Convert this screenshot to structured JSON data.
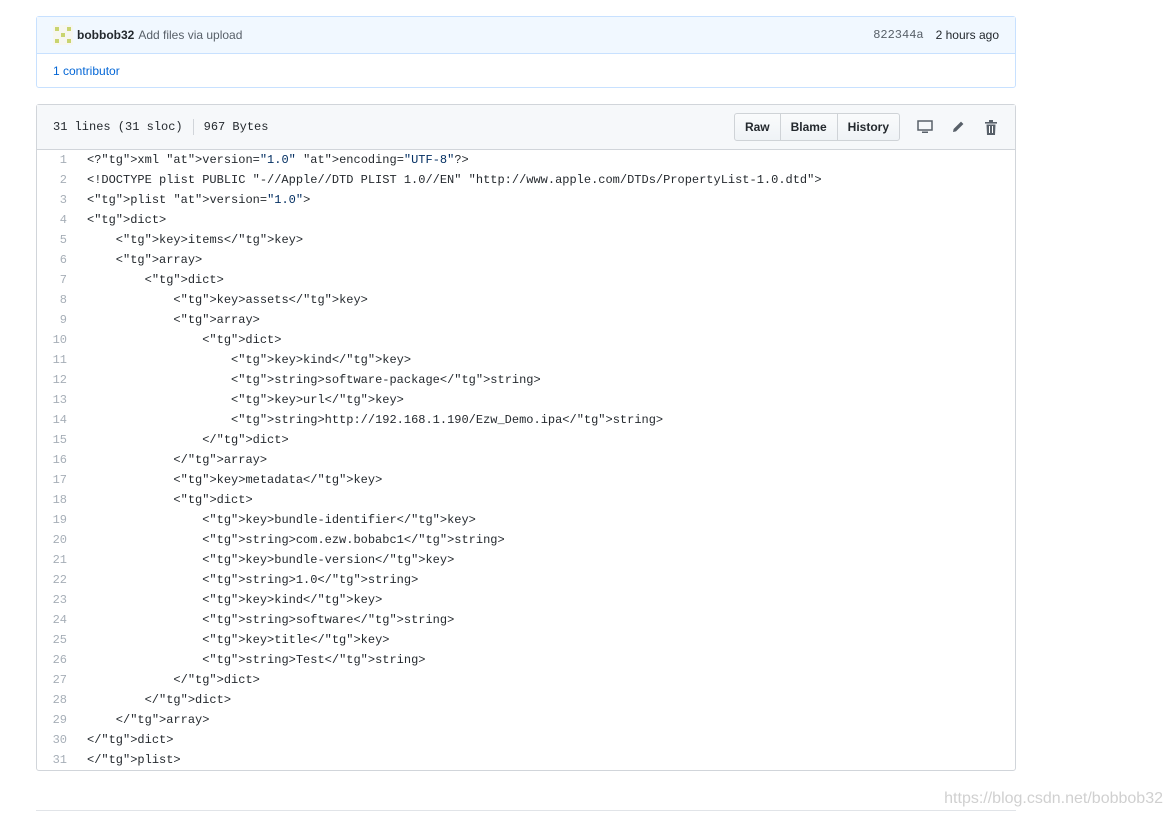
{
  "commit": {
    "author": "bobbob32",
    "message": "Add files via upload",
    "sha": "822344a",
    "time_ago": "2 hours ago",
    "contributors": "1 contributor"
  },
  "file": {
    "lines_info": "31 lines (31 sloc)",
    "size": "967 Bytes",
    "buttons": {
      "raw": "Raw",
      "blame": "Blame",
      "history": "History"
    },
    "icons": [
      "desktop-icon",
      "pencil-icon",
      "trash-icon"
    ]
  },
  "code_lines": [
    "<?xml version=\"1.0\" encoding=\"UTF-8\"?>",
    "<!DOCTYPE plist PUBLIC \"-//Apple//DTD PLIST 1.0//EN\" \"http://www.apple.com/DTDs/PropertyList-1.0.dtd\">",
    "<plist version=\"1.0\">",
    "<dict>",
    "    <key>items</key>",
    "    <array>",
    "        <dict>",
    "            <key>assets</key>",
    "            <array>",
    "                <dict>",
    "                    <key>kind</key>",
    "                    <string>software-package</string>",
    "                    <key>url</key>",
    "                    <string>http://192.168.1.190/Ezw_Demo.ipa</string>",
    "                </dict>",
    "            </array>",
    "            <key>metadata</key>",
    "            <dict>",
    "                <key>bundle-identifier</key>",
    "                <string>com.ezw.bobabc1</string>",
    "                <key>bundle-version</key>",
    "                <string>1.0</string>",
    "                <key>kind</key>",
    "                <string>software</string>",
    "                <key>title</key>",
    "                <string>Test</string>",
    "            </dict>",
    "        </dict>",
    "    </array>",
    "</dict>",
    "</plist>"
  ],
  "watermark": "https://blog.csdn.net/bobbob32",
  "colors": {
    "tag": "#22863a",
    "attr": "#6f42c1",
    "string": "#032f62",
    "link": "#0366d6"
  }
}
